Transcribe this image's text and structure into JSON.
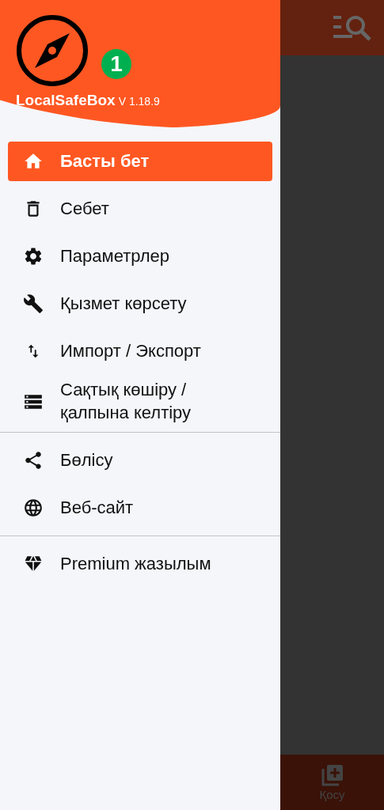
{
  "drawer": {
    "app_name": "LocalSafeBox",
    "version": "V 1.18.9",
    "badge": "1"
  },
  "menu_sections": [
    {
      "items": [
        {
          "label": "Басты бет",
          "selected": true
        },
        {
          "label": "Себет",
          "selected": false
        },
        {
          "label": "Параметрлер",
          "selected": false
        },
        {
          "label": "Қызмет көрсету",
          "selected": false
        },
        {
          "label": "Импорт / Экспорт",
          "selected": false
        },
        {
          "label": "Сақтық көшіру / қалпына келтіру",
          "selected": false
        }
      ]
    },
    {
      "items": [
        {
          "label": "Бөлісу",
          "selected": false
        },
        {
          "label": "Веб-сайт",
          "selected": false
        }
      ]
    },
    {
      "items": [
        {
          "label": "Premium жазылым",
          "selected": false
        }
      ]
    }
  ],
  "bottom_bar": {
    "add_label": "Қосу"
  }
}
